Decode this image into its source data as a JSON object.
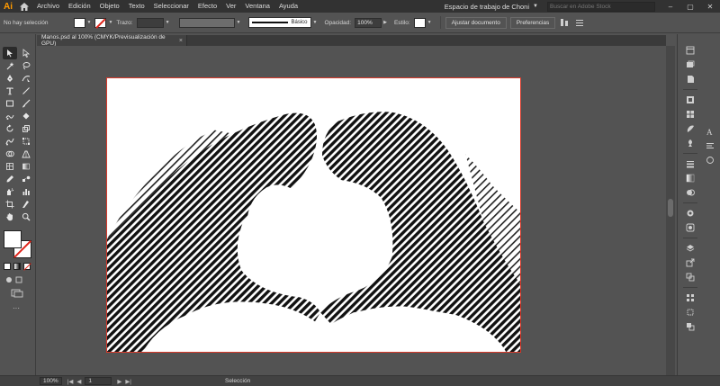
{
  "app": {
    "logo": "Ai",
    "menu": [
      "Archivo",
      "Edición",
      "Objeto",
      "Texto",
      "Seleccionar",
      "Efecto",
      "Ver",
      "Ventana",
      "Ayuda"
    ],
    "workspace_label": "Espacio de trabajo de Choni",
    "search_placeholder": "Buscar en Adobe Stock",
    "window_controls": [
      "–",
      "▢",
      "✕"
    ]
  },
  "control_bar": {
    "selection_label": "No hay selección",
    "stroke_label": "Trazo:",
    "stroke_style": "Básico",
    "opacity_label": "Opacidad:",
    "opacity_value": "100%",
    "style_label": "Estilo:",
    "document_setup_button": "Ajustar documento",
    "preferences_button": "Preferencias"
  },
  "document": {
    "tab_title": "Manos.psd al 100% (CMYK/Previsualización de GPU)",
    "close": "×"
  },
  "status_bar": {
    "zoom": "100%",
    "artboard_number": "1",
    "current_tool": "Selección"
  },
  "colors": {
    "accent": "#ff9a00",
    "artboard_border": "#d7392a",
    "none_slash": "#e0251b"
  }
}
